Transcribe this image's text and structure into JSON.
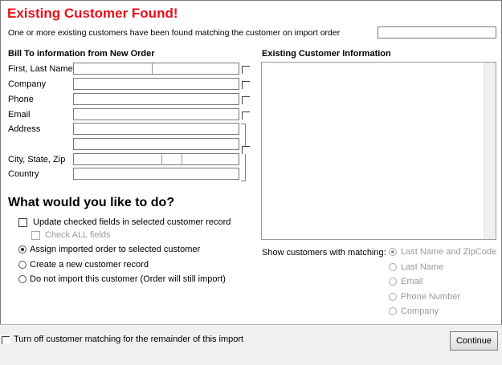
{
  "dialog": {
    "title": "Existing Customer Found!",
    "subtitle": "One or more existing customers have been found matching the customer on import order"
  },
  "bill_to": {
    "heading": "Bill To information from New Order",
    "fields": {
      "name_label": "First, Last Name",
      "company_label": "Company",
      "phone_label": "Phone",
      "email_label": "Email",
      "address_label": "Address",
      "city_label": "City, State, Zip",
      "country_label": "Country"
    }
  },
  "existing": {
    "heading": "Existing Customer Information"
  },
  "actions": {
    "heading": "What would you like to do?",
    "update_checked": "Update checked fields in selected customer record",
    "check_all": "Check ALL fields",
    "assign": "Assign imported order to selected customer",
    "create_new": "Create a new customer record",
    "do_not_import": "Do not import this customer (Order will still import)",
    "selected": "assign"
  },
  "matching": {
    "label": "Show customers with matching:",
    "options": [
      "Last Name and ZipCode",
      "Last Name",
      "Email",
      "Phone Number",
      "Company"
    ],
    "selected": "Last Name and ZipCode"
  },
  "footer": {
    "turn_off": "Turn off customer matching for the remainder of this import",
    "continue": "Continue"
  }
}
